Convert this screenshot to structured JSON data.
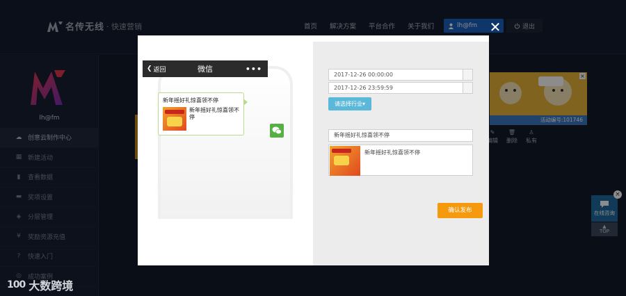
{
  "brand": {
    "name": "名传无线",
    "tagline": "· 快速营销"
  },
  "nav": [
    "首页",
    "解决方案",
    "平台合作",
    "关于我们"
  ],
  "user": {
    "name": "lh@fm",
    "logout_label": "退出"
  },
  "sidebar": {
    "username": "lh@fm",
    "items": [
      {
        "label": "创意云制作中心",
        "icon": "cloud-icon",
        "active": true
      },
      {
        "label": "新建活动",
        "icon": "building-icon"
      },
      {
        "label": "查看数据",
        "icon": "chart-icon"
      },
      {
        "label": "奖项设置",
        "icon": "briefcase-icon"
      },
      {
        "label": "分层管理",
        "icon": "layers-icon"
      },
      {
        "label": "奖励资源充值",
        "icon": "yen-icon"
      },
      {
        "label": "快速入门",
        "icon": "question-icon"
      },
      {
        "label": "成功案例",
        "icon": "case-icon"
      }
    ]
  },
  "banner": {
    "activity_id": "活动编号:101746"
  },
  "actions": [
    "编辑",
    "删除",
    "私有"
  ],
  "float": {
    "chat_label": "在线咨询",
    "top_label": "TOP"
  },
  "watermark": {
    "text": "大数跨境",
    "logo": "100"
  },
  "modal": {
    "wechat": {
      "back_label": "返回",
      "title": "微信",
      "more": "•••",
      "card_title": "新年摇好礼惊喜领不停",
      "card_desc": "新年摇好礼惊喜领不停"
    },
    "form": {
      "start_datetime": "2017-12-26 00:00:00",
      "end_datetime": "2017-12-26 23:59:59",
      "industry_button": "请选择行业",
      "title_value": "新年摇好礼惊喜领不停",
      "desc_value": "新年摇好礼惊喜领不停",
      "publish_button": "确认发布"
    }
  },
  "colors": {
    "accent_blue": "#1b63c4",
    "publish_orange": "#f59a0e",
    "industry_cyan": "#5bb8d8",
    "wechat_green": "#57b045"
  }
}
